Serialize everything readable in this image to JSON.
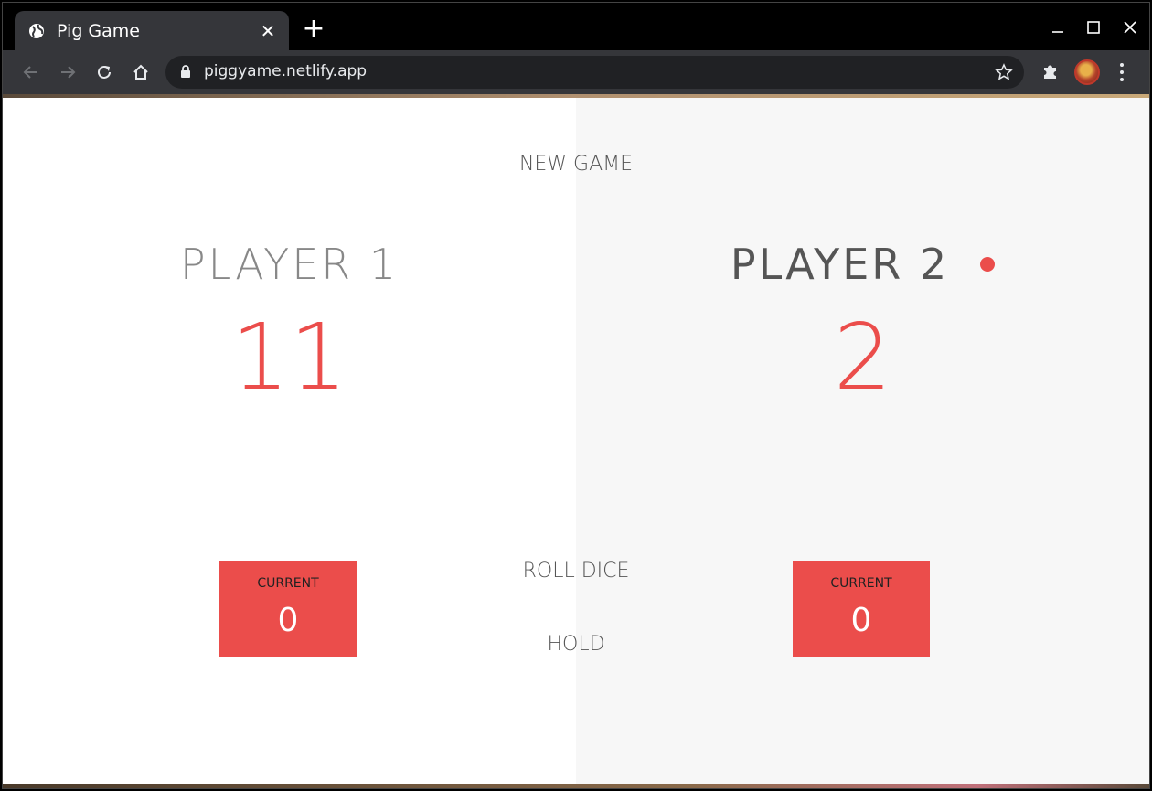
{
  "browser": {
    "tab_title": "Pig Game",
    "url": "piggyame.netlify.app"
  },
  "game": {
    "new_game_label": "NEW GAME",
    "roll_dice_label": "ROLL DICE",
    "hold_label": "HOLD",
    "players": [
      {
        "name": "PLAYER 1",
        "score": "11",
        "current_label": "CURRENT",
        "current_score": "0",
        "active": false
      },
      {
        "name": "PLAYER 2",
        "score": "2",
        "current_label": "CURRENT",
        "current_score": "0",
        "active": true
      }
    ],
    "accent_color": "#eb4d4b"
  }
}
